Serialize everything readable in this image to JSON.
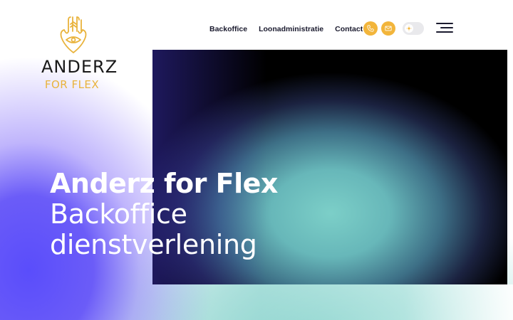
{
  "brand": {
    "name": "ANDERZ",
    "tagline": "FOR FLEX",
    "logo_icon": "hamsa-hand-icon",
    "accent_color": "#e9b33c"
  },
  "nav": {
    "items": [
      {
        "label": "Backoffice"
      },
      {
        "label": "Loonadministratie"
      },
      {
        "label": "Contact"
      }
    ]
  },
  "header_actions": {
    "phone_icon": "phone-icon",
    "mail_icon": "mail-icon",
    "theme_toggle_icon": "sun-icon",
    "menu_icon": "hamburger-menu-icon"
  },
  "hero": {
    "title": "Anderz for Flex",
    "subtitle_line1": "Backoffice",
    "subtitle_line2": "dienstverlening"
  },
  "colors": {
    "icon_button": "#f2b53b",
    "purple": "#5a4dfb",
    "teal": "#7ccfc8"
  }
}
